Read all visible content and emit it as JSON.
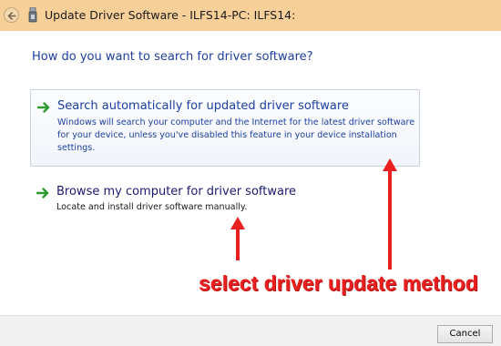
{
  "window": {
    "title": "Update Driver Software - ILFS14-PC: ILFS14:"
  },
  "heading": "How do you want to search for driver software?",
  "options": [
    {
      "title": "Search automatically for updated driver software",
      "description": "Windows will search your computer and the Internet for the latest driver software for your device, unless you've disabled this feature in your device installation settings.",
      "icon": "green-arrow-icon"
    },
    {
      "title": "Browse my computer for driver software",
      "description": "Locate and install driver software manually.",
      "icon": "green-arrow-icon"
    }
  ],
  "annotation": {
    "text": "select driver update method",
    "color": "#e8201f"
  },
  "footer": {
    "cancel_label": "Cancel"
  },
  "colors": {
    "titlebar": "#f6d098",
    "link_blue": "#1c3fa0",
    "arrow_green": "#2e9b2e"
  }
}
